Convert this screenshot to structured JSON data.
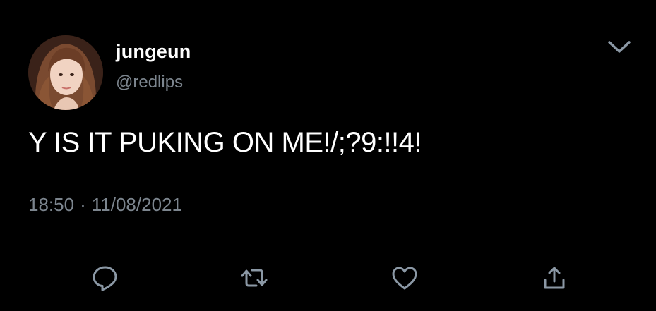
{
  "tweet": {
    "author": {
      "display_name": "jungeun",
      "handle": "@redlips"
    },
    "text": "Y IS IT PUKING ON ME!/;?9:!!4!",
    "time": "18:50",
    "separator": "·",
    "date": "11/08/2021"
  },
  "icons": {
    "menu": "chevron-down-icon",
    "reply": "reply-icon",
    "retweet": "retweet-icon",
    "like": "heart-icon",
    "share": "share-icon"
  },
  "colors": {
    "background": "#000000",
    "primary_text": "#ffffff",
    "secondary_text": "#7c858e",
    "divider": "#38444d",
    "icon": "#8b98a5"
  }
}
